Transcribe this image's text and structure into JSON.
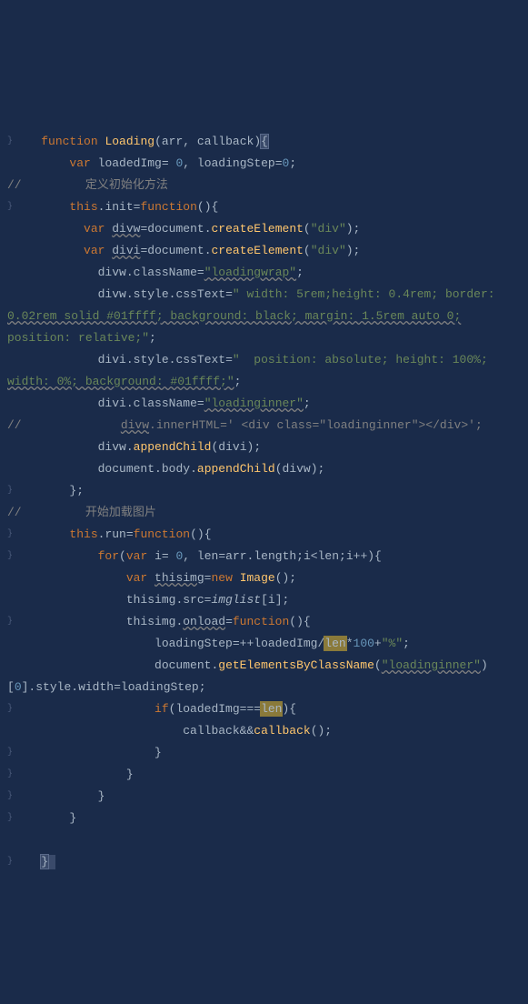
{
  "code": {
    "l1": {
      "kw1": "function",
      "fn": "Loading",
      "p1": "arr",
      "p2": "callback",
      "brace": "{"
    },
    "l2": {
      "kw": "var",
      "v1": "loadedImg",
      "eq": "=",
      "n1": "0",
      "v2": "loadingStep",
      "n2": "0"
    },
    "l3": {
      "com": "//",
      "txt": "定义初始化方法"
    },
    "l4": {
      "th": "this",
      "prop": "init",
      "kw": "function"
    },
    "l5": {
      "kw": "var",
      "v": "divw",
      "obj": "document",
      "m": "createElement",
      "s": "\"div\""
    },
    "l6": {
      "kw": "var",
      "v": "divi",
      "obj": "document",
      "m": "createElement",
      "s": "\"div\""
    },
    "l7": {
      "v": "divw",
      "p": "className",
      "s": "\"loadingwrap\""
    },
    "l8": {
      "v": "divw",
      "p": "style",
      "p2": "cssText",
      "s": "\" width: 5rem;height: 0.4rem; border:"
    },
    "l9": {
      "s": "0.02rem solid #01ffff; background: black; margin: 1.5rem auto 0;"
    },
    "l10": {
      "s": "position: relative;\""
    },
    "l11": {
      "v": "divi",
      "p": "style",
      "p2": "cssText",
      "s": "\"  position: absolute; height: 100%;"
    },
    "l12": {
      "s": "width: 0%; background: #01ffff;\""
    },
    "l13": {
      "v": "divi",
      "p": "className",
      "s": "\"loadinginner\""
    },
    "l14": {
      "com": "//",
      "v": "divw",
      "p": "innerHTML",
      "s": "' <div class=\"loadinginner\"></div>'"
    },
    "l15": {
      "v": "divw",
      "m": "appendChild",
      "a": "divi"
    },
    "l16": {
      "o": "document",
      "p": "body",
      "m": "appendChild",
      "a": "divw"
    },
    "l17": {
      "brace": "};"
    },
    "l18": {
      "com": "//",
      "txt": "开始加载图片"
    },
    "l19": {
      "th": "this",
      "prop": "run",
      "kw": "function"
    },
    "l20": {
      "kw": "for",
      "kw2": "var",
      "v": "i",
      "n1": "0",
      "v2": "len",
      "a": "arr",
      "p": "length",
      "v3": "i",
      "v4": "len",
      "v5": "i"
    },
    "l21": {
      "kw": "var",
      "v": "thisimg",
      "kw2": "new",
      "fn": "Image"
    },
    "l22": {
      "v": "thisimg",
      "p": "src",
      "v2": "imglist",
      "v3": "i"
    },
    "l23": {
      "v": "thisimg",
      "p": "onload",
      "kw": "function"
    },
    "l24": {
      "v": "loadingStep",
      "v2": "loadedImg",
      "v3": "len",
      "n": "100",
      "s": "\"%\""
    },
    "l25": {
      "o": "document",
      "m": "getElementsByClassName",
      "s": "\"loadinginner\""
    },
    "l26": {
      "n": "0",
      "p": "style",
      "p2": "width",
      "v": "loadingStep"
    },
    "l27": {
      "kw": "if",
      "v": "loadedImg",
      "v2": "len"
    },
    "l28": {
      "v": "callback",
      "v2": "callback"
    },
    "l29": {
      "brace": "}"
    },
    "l30": {
      "brace": "}"
    },
    "l31": {
      "brace": "}"
    },
    "l32": {
      "brace": "}"
    },
    "l33": {
      "brace": "}"
    }
  }
}
